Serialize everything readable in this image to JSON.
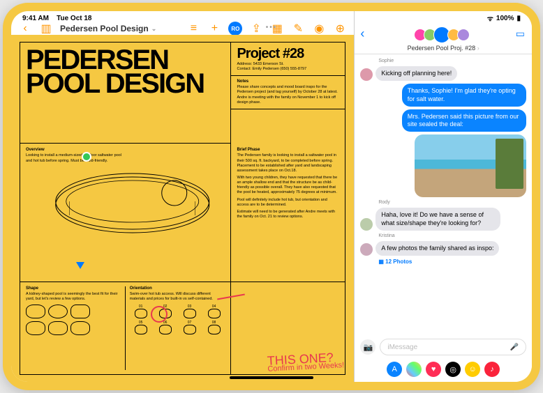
{
  "statusbar": {
    "time": "9:41 AM",
    "date": "Tue Oct 18",
    "battery": "100%"
  },
  "pages": {
    "doc_title": "Pedersen Pool Design",
    "collab_initials": "RO"
  },
  "document": {
    "title_line1": "PEDERSEN",
    "title_line2": "POOL DESIGN",
    "project_label": "Project #28",
    "address_label": "Address: 5433 Emerson St.",
    "contact_label": "Contact: Emily Pedersen (650) 555-8797",
    "notes_heading": "Notes",
    "notes_body": "Please share concepts and mood board inspo for the Pedersen project (and tag yourself) by October 28 at latest. Andre is meeting with the family on November 1 to kick off design phase.",
    "overview_heading": "Overview",
    "overview_body": "Looking to install a medium-sized outdoor saltwater pool and hot tub before spring. Must be child-friendly.",
    "brief_heading": "Brief Phase",
    "brief_p1": "The Pedersen family is looking to install a saltwater pool in their 500 sq. ft. backyard, to be completed before spring. Placement to be established after yard and landscaping assessment takes place on Oct.18.",
    "brief_p2": "With two young children, they have requested that there be an ample shallow end and that the structure be as child-friendly as possible overall. They have also requested that the pool be heated, approximately 75 degrees at minimum.",
    "brief_p3": "Pool will definitely include hot tub, but orientation and access are to be determined.",
    "brief_p4": "Estimate will need to be generated after Andre meets with the family on Oct. 21 to review options.",
    "shape_heading": "Shape",
    "shape_body": "A kidney-shaped pool is seemingly the best fit for their yard, but let's review a few options.",
    "orient_heading": "Orientation",
    "orient_body": "Swim-over hot tub access. Will discuss different materials and prices for built-in vs self-contained.",
    "orient_labels": [
      "01",
      "02",
      "03",
      "04",
      "05",
      "06",
      "07",
      "08"
    ],
    "handwrite_main": "THIS ONE?",
    "handwrite_sub": "Confirm in two Weeks!"
  },
  "messages": {
    "thread_title": "Pedersen Pool Proj. #28",
    "items": [
      {
        "sender": "Sophie",
        "text": "Kicking off planning here!",
        "dir": "in"
      },
      {
        "text": "Thanks, Sophie! I'm glad they're opting for salt water.",
        "dir": "out"
      },
      {
        "text": "Mrs. Pedersen said this picture from our site sealed the deal:",
        "dir": "out"
      },
      {
        "sender": "Rody",
        "text": "Haha, love it! Do we have a sense of what size/shape they're looking for?",
        "dir": "in"
      },
      {
        "sender": "Kristina",
        "text": "A few photos the family shared as inspo:",
        "dir": "in"
      }
    ],
    "photos_link": "12 Photos",
    "input_placeholder": "iMessage"
  }
}
